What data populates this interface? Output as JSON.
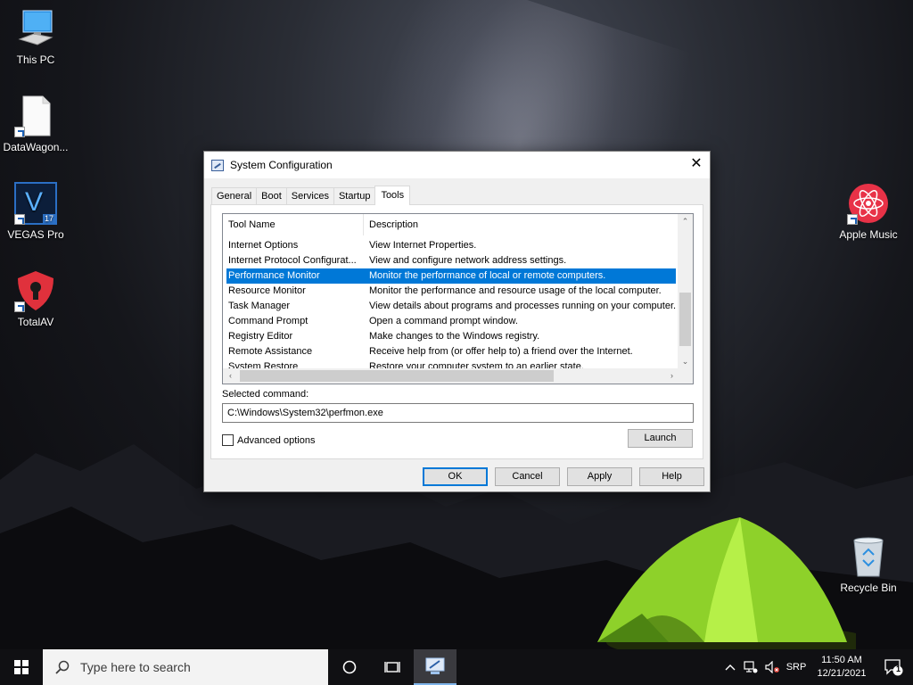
{
  "desktop": {
    "icons": [
      {
        "label": "This PC",
        "icon": "computer-icon"
      },
      {
        "label": "DataWagon...",
        "icon": "file-icon"
      },
      {
        "label": "VEGAS Pro",
        "icon": "vegas-pro-icon",
        "badge": "17",
        "glyph": "V"
      },
      {
        "label": "TotalAV",
        "icon": "totalav-shield-icon"
      },
      {
        "label": "Apple Music",
        "icon": "apple-music-icon"
      },
      {
        "label": "Recycle Bin",
        "icon": "recycle-bin-icon"
      }
    ]
  },
  "dialog": {
    "title": "System Configuration",
    "close_glyph": "✕",
    "tabs": [
      "General",
      "Boot",
      "Services",
      "Startup",
      "Tools"
    ],
    "active_tab": "Tools",
    "list": {
      "columns": [
        "Tool Name",
        "Description"
      ],
      "rows": [
        {
          "name": "Internet Options",
          "desc": "View Internet Properties."
        },
        {
          "name": "Internet Protocol Configurat...",
          "desc": "View and configure network address settings."
        },
        {
          "name": "Performance Monitor",
          "desc": "Monitor the performance of local or remote computers.",
          "selected": true
        },
        {
          "name": "Resource Monitor",
          "desc": "Monitor the performance and resource usage of the local computer."
        },
        {
          "name": "Task Manager",
          "desc": "View details about programs and processes running on your computer."
        },
        {
          "name": "Command Prompt",
          "desc": "Open a command prompt window."
        },
        {
          "name": "Registry Editor",
          "desc": "Make changes to the Windows registry."
        },
        {
          "name": "Remote Assistance",
          "desc": "Receive help from (or offer help to) a friend over the Internet."
        },
        {
          "name": "System Restore",
          "desc": "Restore your computer system to an earlier state."
        }
      ]
    },
    "selected_command_label": "Selected command:",
    "selected_command_value": "C:\\Windows\\System32\\perfmon.exe",
    "advanced_options_label": "Advanced options",
    "advanced_options_checked": false,
    "launch_label": "Launch",
    "buttons": {
      "ok": "OK",
      "cancel": "Cancel",
      "apply": "Apply",
      "help": "Help"
    }
  },
  "taskbar": {
    "search_placeholder": "Type here to search",
    "language": "SRP",
    "time": "11:50 AM",
    "date": "12/21/2021",
    "notification_count": "1"
  },
  "colors": {
    "selection": "#0078d7",
    "taskbar": "#101013",
    "accent_underline": "#7fb4ea"
  }
}
